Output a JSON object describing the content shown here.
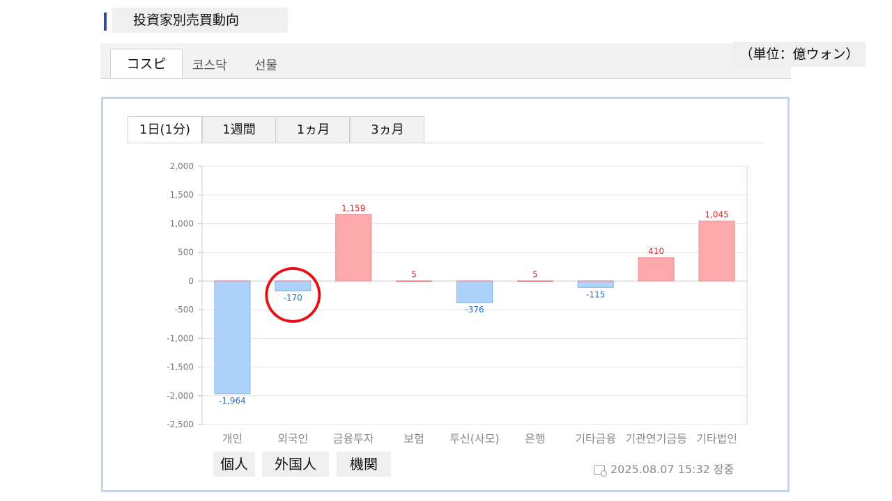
{
  "header": {
    "title": "投資家別売買動向"
  },
  "market_tabs": [
    {
      "label": "コスピ",
      "active": true
    },
    {
      "label": "코스닥",
      "active": false
    },
    {
      "label": "선물",
      "active": false
    }
  ],
  "unit_label": "（単位：億ウォン）",
  "period_tabs": [
    {
      "label": "1日(1分)",
      "active": true
    },
    {
      "label": "1週間",
      "active": false
    },
    {
      "label": "1ヵ月",
      "active": false
    },
    {
      "label": "3ヵ月",
      "active": false
    }
  ],
  "investor_groups": [
    "個人",
    "外国人",
    "機関"
  ],
  "timestamp": "2025.08.07 15:32 장중",
  "colors": {
    "positive_fill": "#fda9ab",
    "positive_stroke": "#f08a8d",
    "positive_label": "#e0242b",
    "negative_fill": "#aed3fb",
    "negative_stroke": "#85b4e6",
    "negative_label": "#1f6fd1",
    "highlight": "#e5121a"
  },
  "chart_data": {
    "type": "bar",
    "categories": [
      "개인",
      "외국인",
      "금융투자",
      "보험",
      "투신(사모)",
      "은행",
      "기타금융",
      "기관연기금등",
      "기타법인"
    ],
    "values": [
      -1964,
      -170,
      1159,
      5,
      -376,
      5,
      -115,
      410,
      1045
    ],
    "data_labels": [
      "-1,964",
      "-170",
      "1,159",
      "5",
      "-376",
      "5",
      "-115",
      "410",
      "1,045"
    ],
    "ylim": [
      -2500,
      2000
    ],
    "yticks": [
      2000,
      1500,
      1000,
      500,
      0,
      -500,
      -1000,
      -1500,
      -2000,
      -2500
    ],
    "ytick_labels": [
      "2,000",
      "1,500",
      "1,000",
      "500",
      "0",
      "-500",
      "-1,000",
      "-1,500",
      "-2,000",
      "-2,500"
    ],
    "xtick_labels": [
      "개인",
      "외국인",
      "금융투자",
      "보험",
      "투신(사모)",
      "은행",
      "기타금융",
      "기관연기금등",
      "기타법인"
    ],
    "grid": true,
    "title": "",
    "xlabel": "",
    "ylabel": "",
    "highlighted_category": "외국인"
  }
}
